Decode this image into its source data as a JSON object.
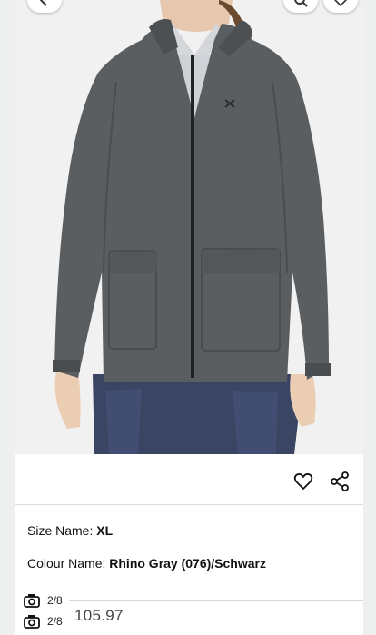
{
  "product": {
    "size_label": "Size Name:",
    "size_value": "XL",
    "colour_label": "Colour Name:",
    "colour_value": "Rhino Gray (076)/Schwarz"
  },
  "gallery": {
    "image_counter_top": "2/8",
    "image_counter_bottom": "2/8"
  },
  "price": {
    "text": "105.97"
  },
  "colors": {
    "jacket": "#5b5e61",
    "jacket_dark": "#3f4245",
    "pants": "#3a4564",
    "background": "#f1f1f1"
  },
  "icons": {
    "back": "back-arrow-icon",
    "search": "search-icon",
    "wishlist_top": "heart-icon",
    "wishlist": "heart-icon",
    "share": "share-icon",
    "camera": "camera-icon"
  }
}
